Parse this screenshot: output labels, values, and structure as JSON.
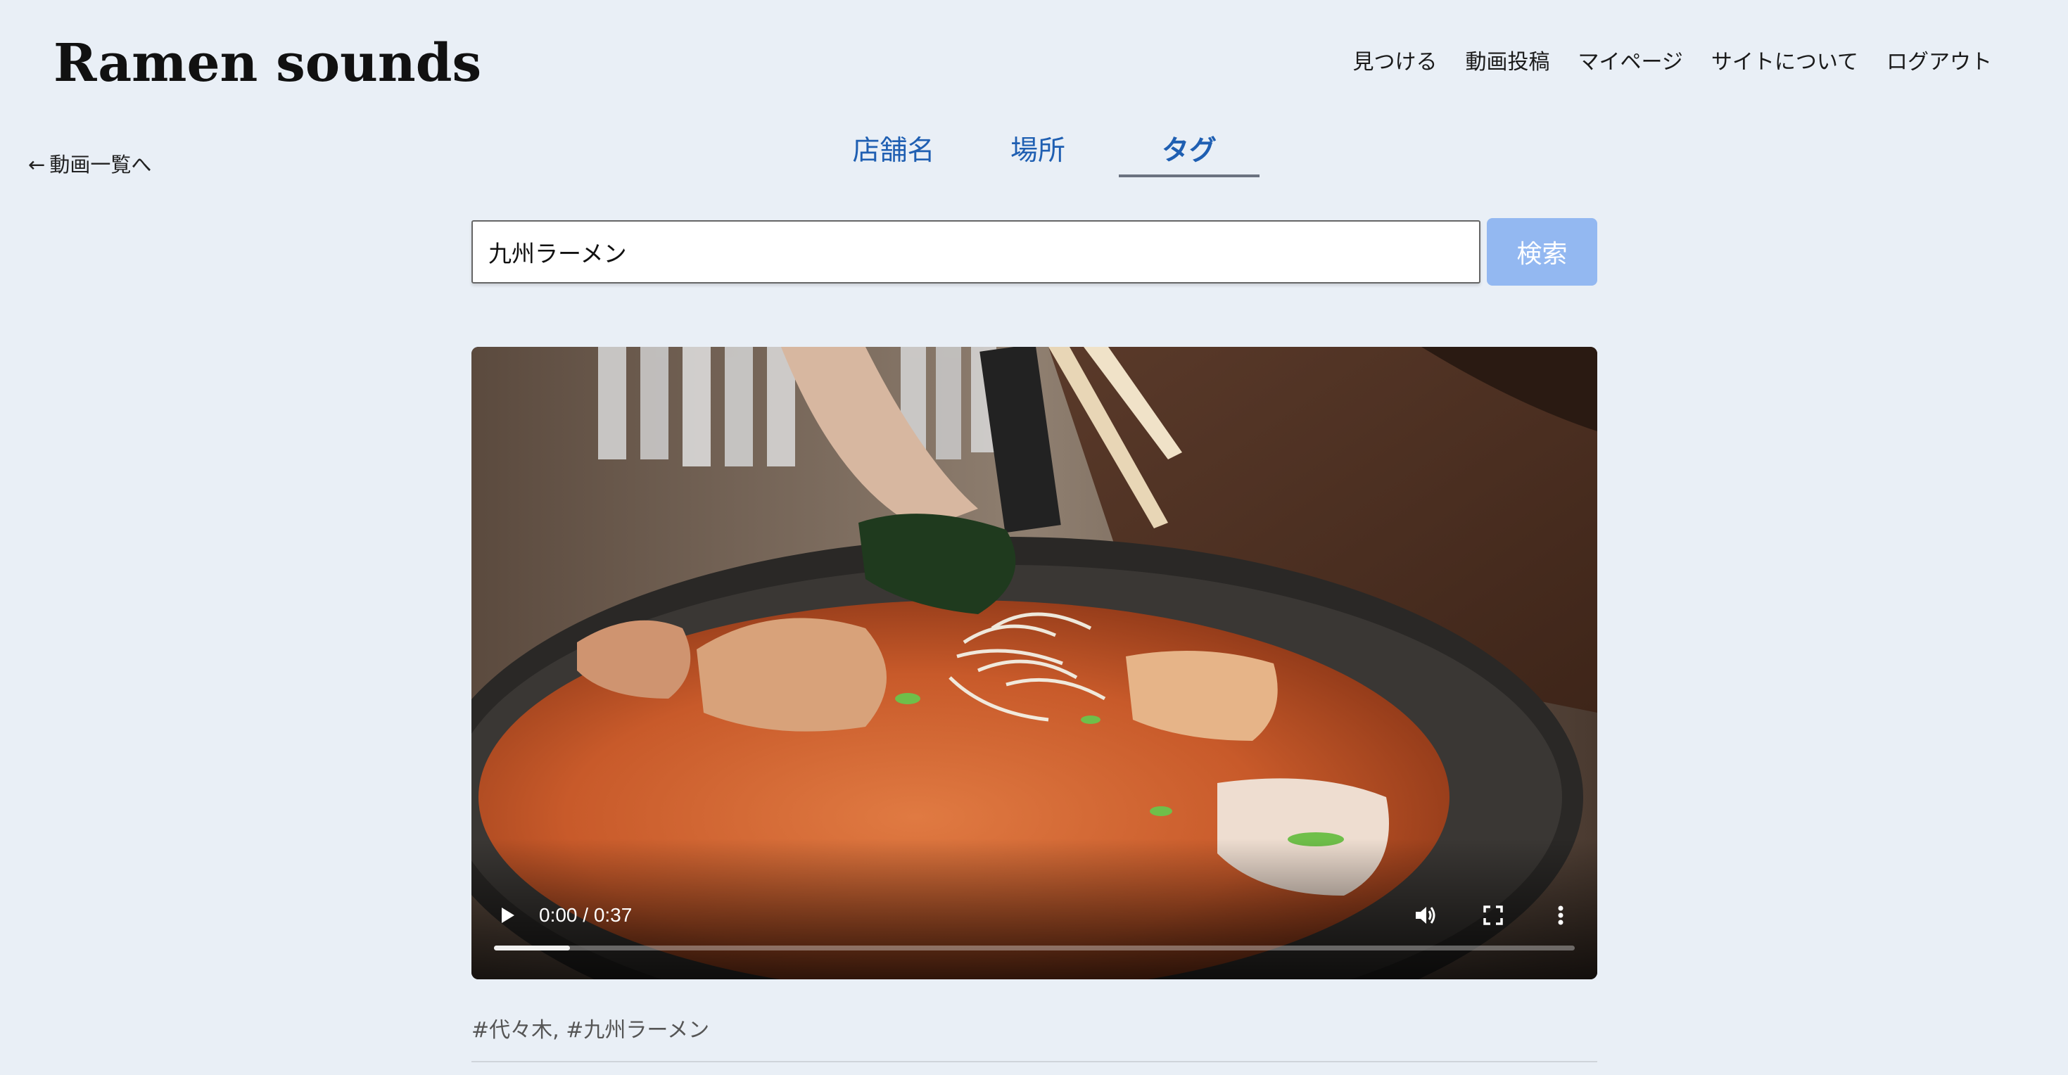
{
  "header": {
    "site_title": "Ramen sounds",
    "nav": [
      "見つける",
      "動画投稿",
      "マイページ",
      "サイトについて",
      "ログアウト"
    ]
  },
  "back_link": {
    "arrow": "←",
    "label": "動画一覧へ"
  },
  "tabs": {
    "items": [
      "店舗名",
      "場所",
      "タグ"
    ],
    "active": "タグ"
  },
  "search": {
    "value": "九州ラーメン",
    "button_label": "検索"
  },
  "video": {
    "time": "0:00 / 0:37",
    "buffered_fraction": 0.07,
    "icons": [
      "play-icon",
      "volume-icon",
      "fullscreen-icon",
      "more-vert-icon"
    ]
  },
  "tags_text": "#代々木, #九州ラーメン",
  "colors": {
    "background": "#e9eff6",
    "tab_text": "#1f5fb2",
    "search_button": "#93b8f1"
  }
}
